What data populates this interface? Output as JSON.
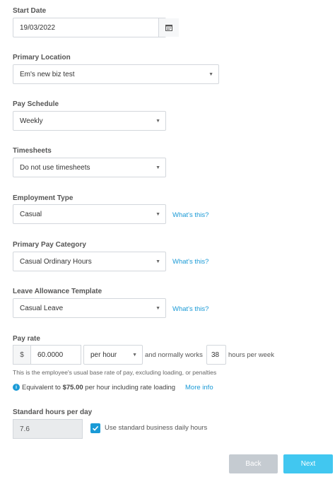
{
  "start_date": {
    "label": "Start Date",
    "value": "19/03/2022"
  },
  "primary_location": {
    "label": "Primary Location",
    "value": "Em's new biz test"
  },
  "pay_schedule": {
    "label": "Pay Schedule",
    "value": "Weekly"
  },
  "timesheets": {
    "label": "Timesheets",
    "value": "Do not use timesheets"
  },
  "employment_type": {
    "label": "Employment Type",
    "value": "Casual",
    "help_link": "What's this?"
  },
  "primary_pay_category": {
    "label": "Primary Pay Category",
    "value": "Casual Ordinary Hours",
    "help_link": "What's this?"
  },
  "leave_allowance_template": {
    "label": "Leave Allowance Template",
    "value": "Casual Leave",
    "help_link": "What's this?"
  },
  "pay_rate": {
    "label": "Pay rate",
    "currency_symbol": "$",
    "value": "60.0000",
    "unit": "per hour",
    "normally_works_text": "and normally works",
    "hours_value": "38",
    "hours_suffix": "hours per week",
    "hint": "This is the employee's usual base rate of pay, excluding loading, or penalties",
    "equivalent_prefix": "Equivalent to",
    "equivalent_amount": "$75.00",
    "equivalent_suffix": "per hour including rate loading",
    "more_info_link": "More info"
  },
  "standard_hours": {
    "label": "Standard hours per day",
    "value": "7.6",
    "checkbox_label": "Use standard business daily hours",
    "checked": true
  },
  "buttons": {
    "back": "Back",
    "next": "Next"
  },
  "colors": {
    "accent": "#1a9ad6",
    "next_button": "#41c7f0",
    "back_button": "#c5cbd1"
  },
  "icons": {
    "date_picker": "calendar-icon",
    "select_caret": "caret-down-icon",
    "info": "info-icon",
    "check": "check-icon"
  }
}
